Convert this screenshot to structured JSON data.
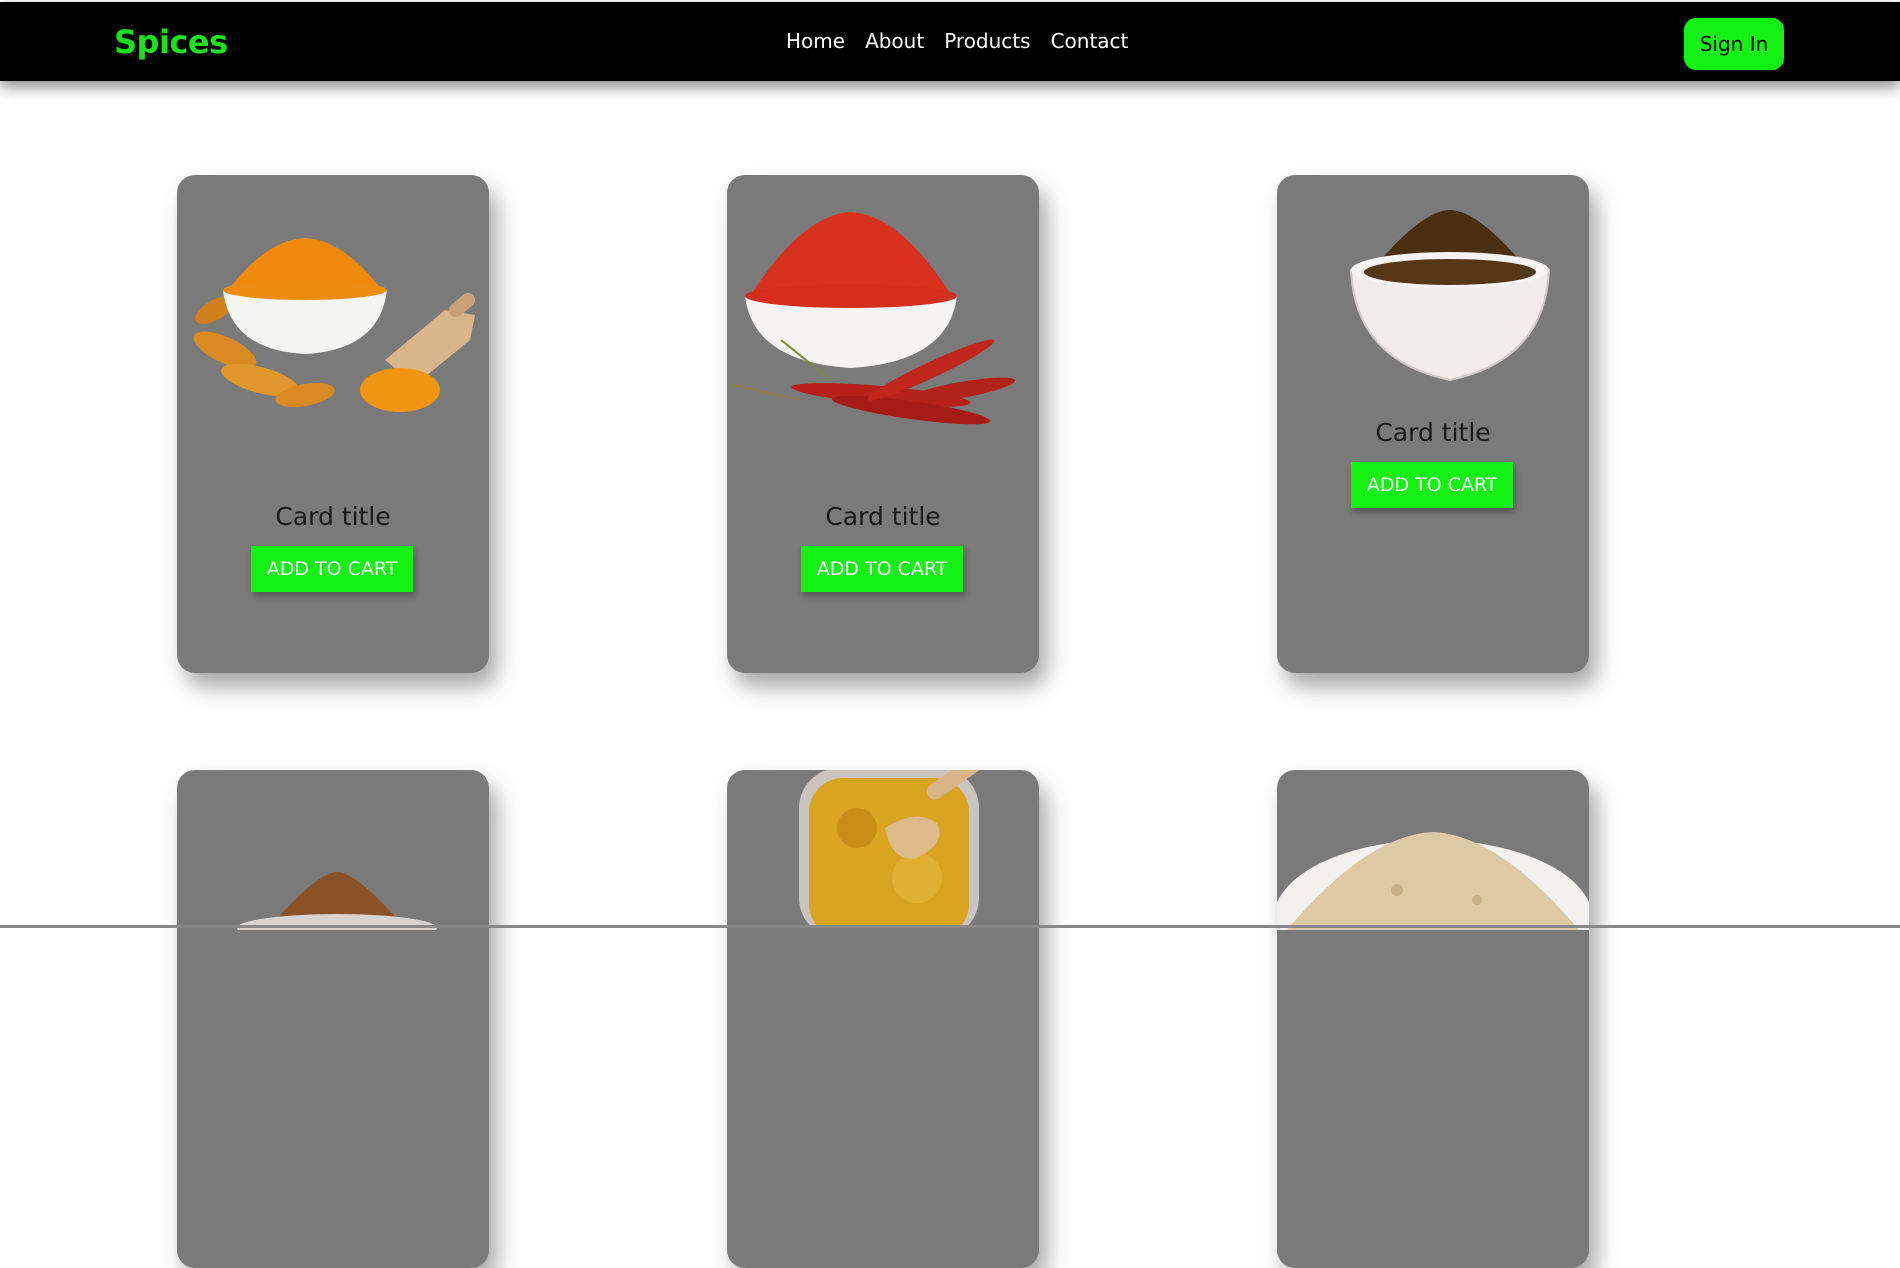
{
  "nav": {
    "brand": "Spices",
    "links": [
      "Home",
      "About",
      "Products",
      "Contact"
    ],
    "signin_label": "Sign In"
  },
  "cards": [
    {
      "title": "Card title",
      "button": "ADD TO CART",
      "image": "turmeric-powder-bowl"
    },
    {
      "title": "Card title",
      "button": "ADD TO CART",
      "image": "red-chili-powder-bowl"
    },
    {
      "title": "Card title",
      "button": "ADD TO CART",
      "image": "garam-masala-bowl"
    },
    {
      "title": "",
      "button": "",
      "image": "cinnamon-powder-bowl"
    },
    {
      "title": "",
      "button": "",
      "image": "curry-powder-jar"
    },
    {
      "title": "",
      "button": "",
      "image": "ginger-powder-bowl"
    }
  ],
  "colors": {
    "brand": "#19e319",
    "nav_bg": "#000000",
    "accent_button": "#14f214",
    "card_bg": "#7a7a7a"
  }
}
